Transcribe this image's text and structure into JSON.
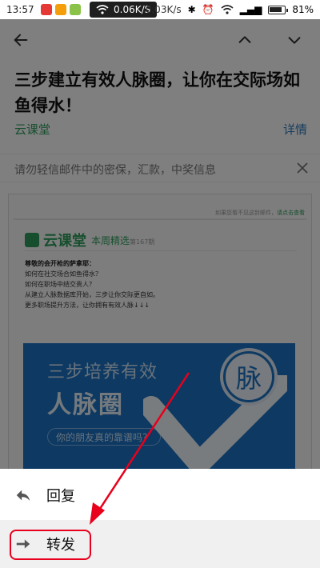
{
  "status_bar": {
    "time": "13:57",
    "net_speed": "0.06K/S",
    "net_speed_dim": "0.03K/s",
    "battery": "81%"
  },
  "email": {
    "subject": "三步建立有效人脉圈，让你在交际场如鱼得水！",
    "sender": "云课堂",
    "details_label": "详情",
    "warning": "请勿轻信邮件中的密保，汇款，中奖信息"
  },
  "content": {
    "top_note": "如果您看不见这封邮件，",
    "top_note_link": "请点击查看",
    "brand_name": "云课堂",
    "brand_issue": "本周精选",
    "brand_issue_no": "第167期",
    "greeting": "尊敬的会开枪的萨拿耶：",
    "lines": [
      "如何在社交场合如鱼得水？",
      "如何在职场中结交贵人？",
      "从建立人脉数据库开始，三步让你交际更自如。",
      "更多职场提升方法，让你拥有有效人脉↓↓↓"
    ],
    "banner_line1": "三步培养有效",
    "banner_line2": "人脉圈",
    "banner_pill": "你的朋友真的靠谱吗？",
    "banner_badge": "脉"
  },
  "sheet": {
    "reply_label": "回复",
    "forward_label": "转发"
  },
  "colors": {
    "accent_green": "#2e9e5c",
    "link_blue": "#2e7bbf",
    "highlight_red": "#e8001c",
    "banner_blue": "#1a73c4"
  },
  "icons": [
    "back-arrow-icon",
    "chevron-up-icon",
    "chevron-down-icon",
    "close-icon",
    "reply-icon",
    "forward-icon",
    "wifi-icon",
    "battery-icon"
  ]
}
